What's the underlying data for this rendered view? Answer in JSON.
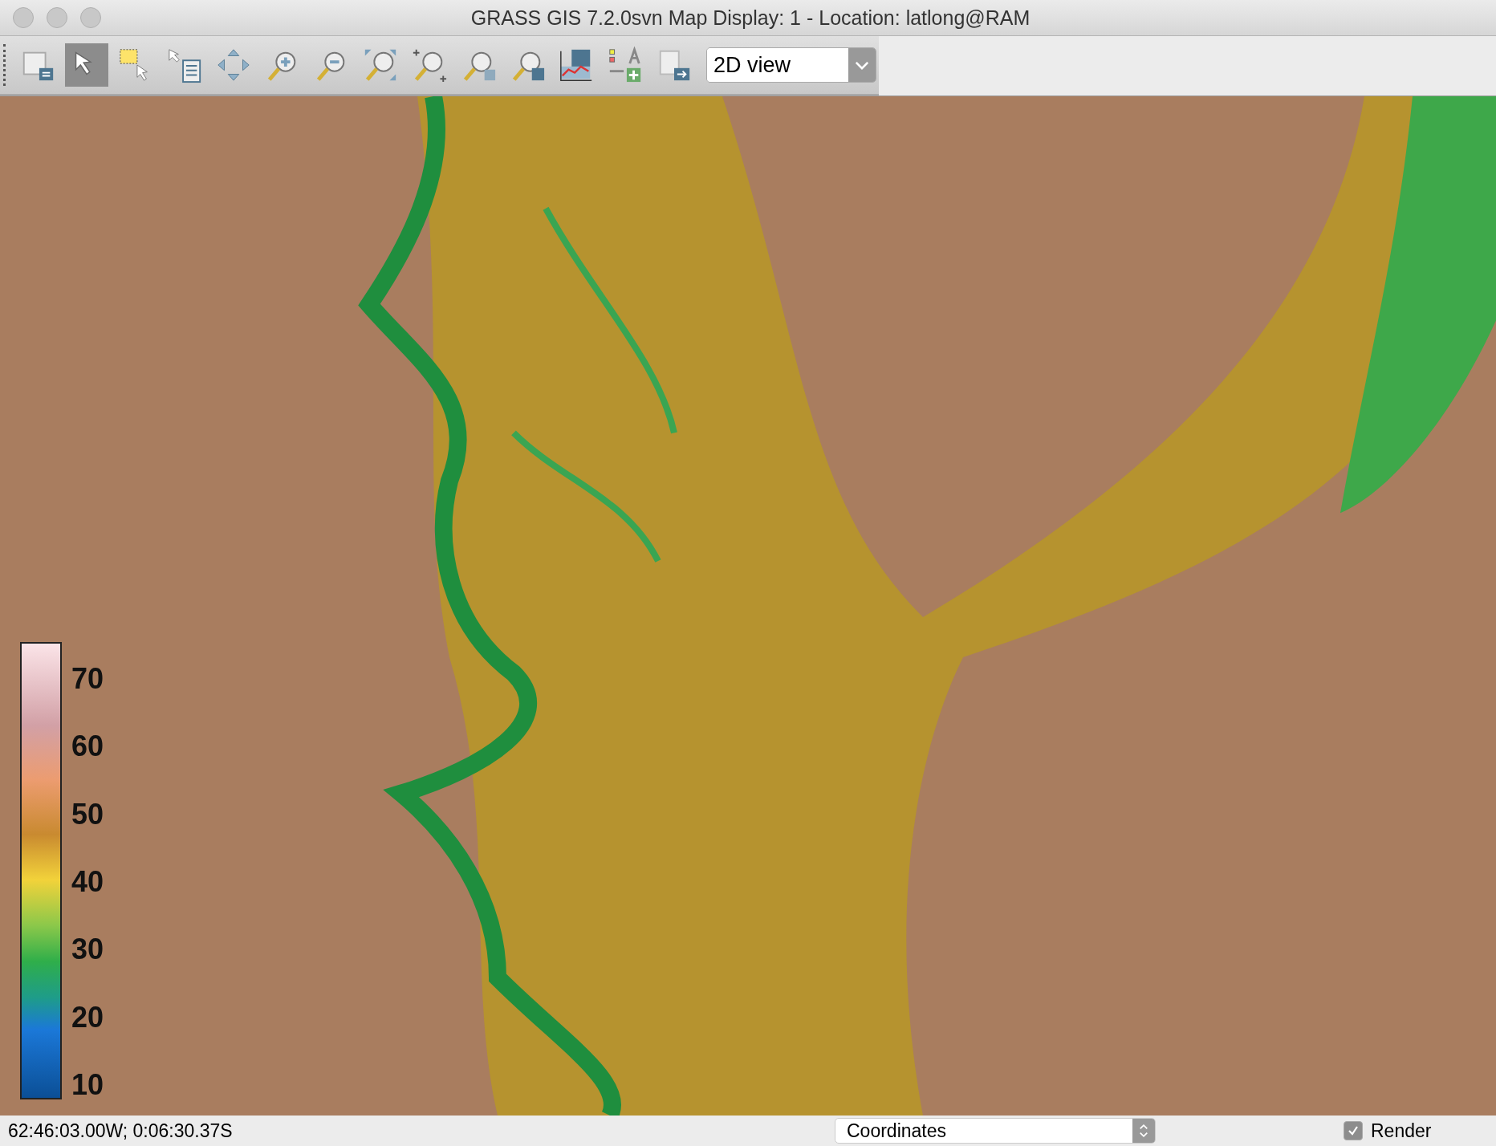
{
  "window": {
    "title": "GRASS GIS 7.2.0svn Map Display: 1 - Location: latlong@RAM"
  },
  "toolbar": {
    "tools": [
      {
        "kind": "display",
        "selected": false
      },
      {
        "kind": "pointer",
        "selected": true
      },
      {
        "kind": "select",
        "selected": false
      },
      {
        "kind": "query",
        "selected": false
      },
      {
        "kind": "pan",
        "selected": false
      },
      {
        "kind": "zoomin",
        "selected": false
      },
      {
        "kind": "zoomout",
        "selected": false
      },
      {
        "kind": "zoomextent",
        "selected": false
      },
      {
        "kind": "zoomregion",
        "selected": false
      },
      {
        "kind": "zoomback",
        "selected": false
      },
      {
        "kind": "zoommenu",
        "selected": false
      },
      {
        "kind": "analyze",
        "selected": false
      },
      {
        "kind": "decorate",
        "selected": false
      },
      {
        "kind": "export",
        "selected": false
      }
    ],
    "view_mode": "2D view"
  },
  "legend": {
    "labels": [
      "70",
      "60",
      "50",
      "40",
      "30",
      "20",
      "10"
    ]
  },
  "status_bar": {
    "coordinates": "62:46:03.00W; 0:06:30.37S",
    "mode": "Coordinates",
    "render": {
      "label": "Render",
      "checked": true
    }
  }
}
